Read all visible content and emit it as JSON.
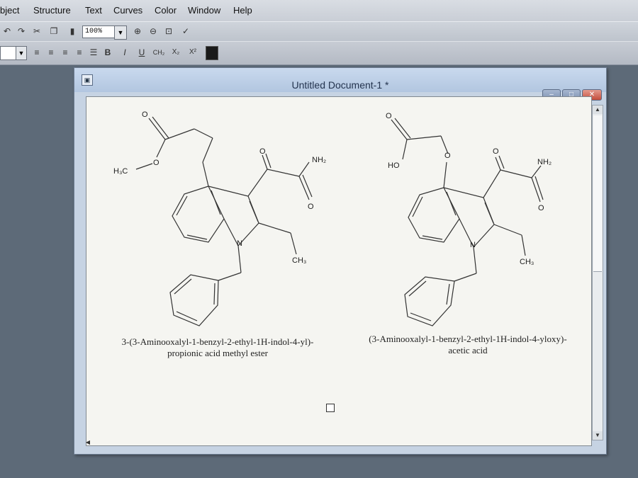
{
  "menubar": {
    "items": [
      "bject",
      "Structure",
      "Text",
      "Curves",
      "Color",
      "Window",
      "Help"
    ]
  },
  "toolbar": {
    "zoom_value": "100%",
    "format_buttons": [
      "B",
      "I",
      "U",
      "CH₂",
      "X₂",
      "X²"
    ]
  },
  "document": {
    "title": "Untitled Document-1 *"
  },
  "molecules": [
    {
      "labels": {
        "o_top": "O",
        "o_ester": "O",
        "h3c": "H₃C",
        "o_keto": "O",
        "nh2": "NH₂",
        "o_amide": "O",
        "n": "N",
        "ch3": "CH₃"
      },
      "caption_line1": "3-(3-Aminooxalyl-1-benzyl-2-ethyl-1H-indol-4-yl)-",
      "caption_line2": "propionic acid methyl ester"
    },
    {
      "labels": {
        "o_top": "O",
        "ho": "HO",
        "o_ether": "O",
        "o_keto": "O",
        "nh2": "NH₂",
        "o_amide": "O",
        "n": "N",
        "ch3": "CH₃"
      },
      "caption_line1": "(3-Aminooxalyl-1-benzyl-2-ethyl-1H-indol-4-yloxy)-",
      "caption_line2": "acetic acid"
    }
  ]
}
